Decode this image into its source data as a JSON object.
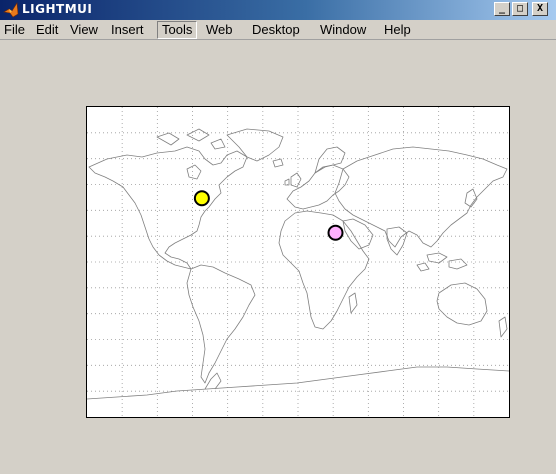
{
  "window": {
    "title": "LIGHTMUI",
    "controls": {
      "minimize": "_",
      "maximize": "□",
      "close": "X"
    }
  },
  "menu": {
    "items": [
      "File",
      "Edit",
      "View",
      "Insert",
      "Tools",
      "Web",
      "Desktop",
      "Window",
      "Help"
    ],
    "active_index": 4
  },
  "colors": {
    "title_bar": "#0a246a",
    "window_bg": "#d4d0c8",
    "coastline": "#808080",
    "grid": "#9a9a9a",
    "marker_1": "#ffff00",
    "marker_2": "#ffb0ff"
  },
  "map": {
    "projection": "equirectangular world map",
    "grid": true,
    "markers": [
      {
        "name": "yellow-light-marker",
        "lon": -82,
        "lat": 37,
        "color": "#ffff00"
      },
      {
        "name": "magenta-light-marker",
        "lon": 32,
        "lat": 17,
        "color": "#ffb0ff"
      }
    ]
  }
}
